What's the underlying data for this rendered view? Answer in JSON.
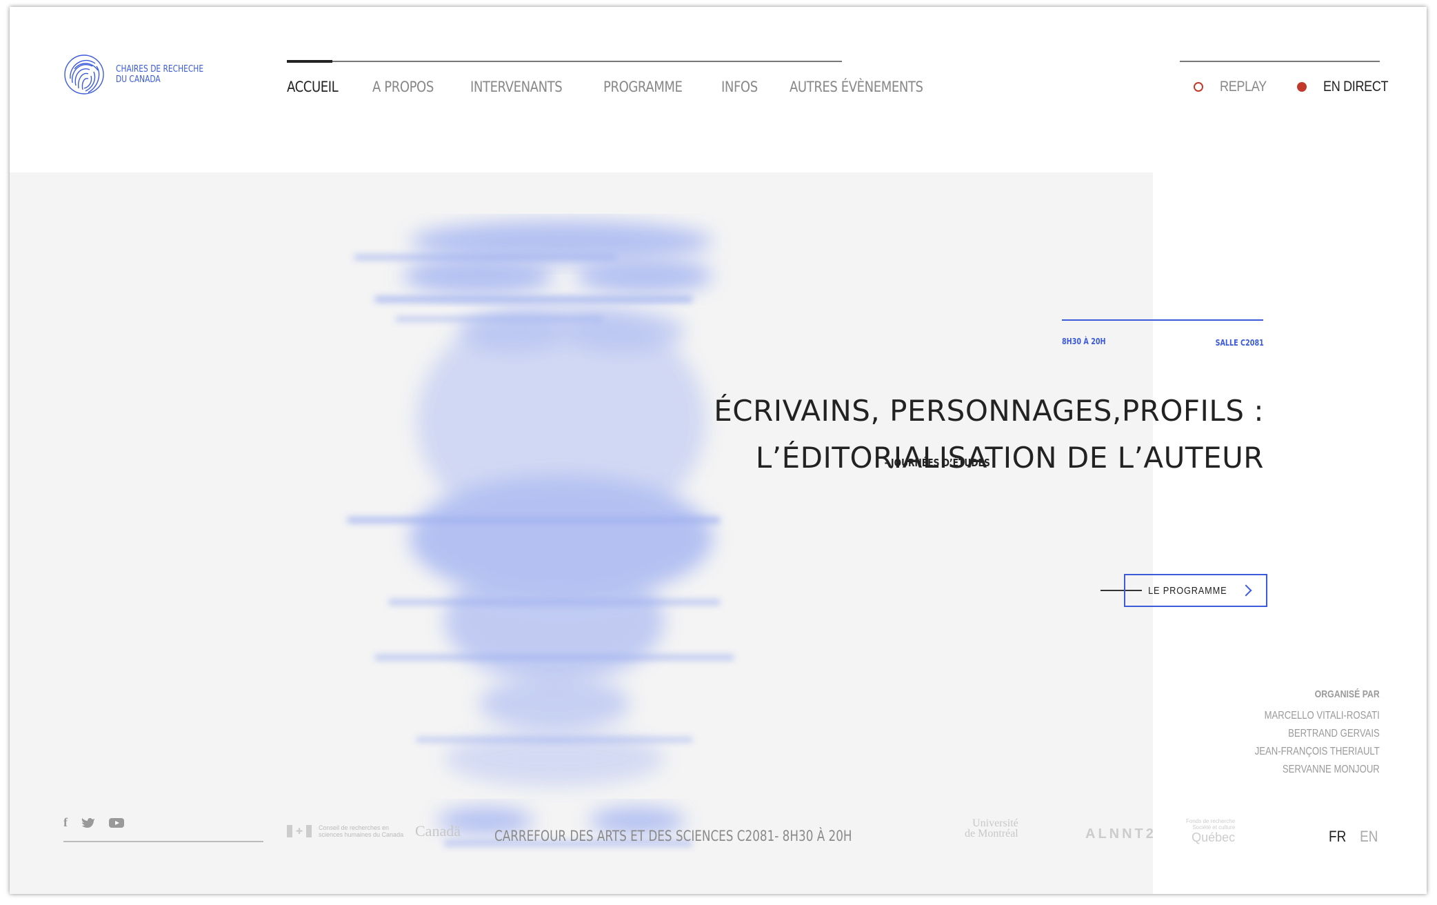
{
  "logo": {
    "line1": "CHAIRES DE RECHECHE",
    "line2": "DU CANADA"
  },
  "nav": {
    "items": [
      {
        "label": "ACCUEIL",
        "active": true
      },
      {
        "label": "A PROPOS",
        "active": false
      },
      {
        "label": "INTERVENANTS",
        "active": false
      },
      {
        "label": "PROGRAMME",
        "active": false
      },
      {
        "label": "INFOS",
        "active": false
      },
      {
        "label": "AUTRES ÉVÈNEMENTS",
        "active": false
      }
    ],
    "replay_label": "REPLAY",
    "live_label": "EN DIRECT"
  },
  "hero": {
    "tag": "- JOURNÉES D’ÉTUDES",
    "time": "8H30 À 20H",
    "room": "SALLE C2081",
    "title_line1": "ÉCRIVAINS, PERSONNAGES,PROFILS :",
    "title_line2": "L’ÉDITORIALISATION DE L’AUTEUR",
    "button_label": "LE PROGRAMME"
  },
  "organizers": {
    "title": "ORGANISÉ PAR",
    "names": [
      "MARCELLO VITALI-ROSATI",
      "BERTRAND GERVAIS",
      "JEAN-FRANÇOIS THERIAULT",
      "SERVANNE MONJOUR"
    ]
  },
  "footer": {
    "social": [
      "facebook-icon",
      "twitter-icon",
      "youtube-icon"
    ],
    "crsh_text": "Conseil de recherches en sciences humaines du Canada",
    "canada_word": "Canadä",
    "venue": "CARREFOUR DES ARTS ET DES SCIENCES C2081- 8H30 À 20H",
    "udem_line1": "Université",
    "udem_line2": "de Montréal",
    "alnt": "ALNNT2",
    "qc_small1": "Fonds de recherche",
    "qc_small2": "Société et culture",
    "qc_big": "Québec",
    "lang_fr": "FR",
    "lang_en": "EN"
  },
  "colors": {
    "accent": "#3b5bdb",
    "live": "#c0392b",
    "hero_bg": "#f4f4f4",
    "face": "#a9b8f2"
  }
}
